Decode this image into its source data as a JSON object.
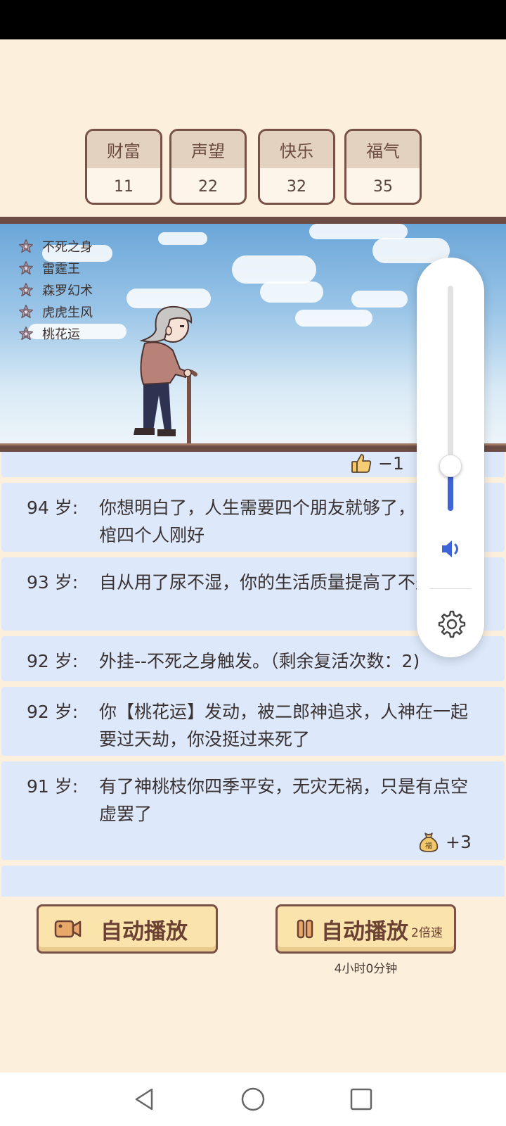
{
  "stats": [
    {
      "label": "财富",
      "value": "11"
    },
    {
      "label": "声望",
      "value": "22"
    },
    {
      "label": "快乐",
      "value": "32"
    },
    {
      "label": "福气",
      "value": "35"
    }
  ],
  "cheats": [
    "不死之身",
    "雷霆王",
    "森罗幻术",
    "虎虎生风",
    "桃花运"
  ],
  "log": {
    "partial_top_reward": "−1",
    "entries": [
      {
        "age": "94 岁:",
        "text": "你想明白了，人生需要四个朋友就够了，因为抬棺四个人刚好"
      },
      {
        "age": "93 岁:",
        "text": "自从用了尿不湿，你的生活质量提高了不少"
      },
      {
        "age": "92 岁:",
        "text": "外挂--不死之身触发。（剩余复活次数：2)"
      },
      {
        "age": "92 岁:",
        "text": "你【桃花运】发动，被二郎神追求，人神在一起要过天劫，你没挺过来死了"
      },
      {
        "age": "91 岁:",
        "text": "有了神桃枝你四季平安，无灾无祸，只是有点空虚罢了",
        "reward": "+3",
        "reward_icon": "luck-bag-icon",
        "reward_icon_label": "福"
      }
    ]
  },
  "volume": {
    "level": 0.2
  },
  "buttons": {
    "auto_play": "自动播放",
    "fast_play": "自动播放",
    "fast_play_speed": "2倍速",
    "remaining_time": "4小时0分钟"
  },
  "colors": {
    "background": "#fcefdc",
    "card_border": "#7a5146",
    "log_bg": "#dde9fb",
    "accent_blue": "#3f63d8",
    "button_bg": "#fbe3ac"
  }
}
